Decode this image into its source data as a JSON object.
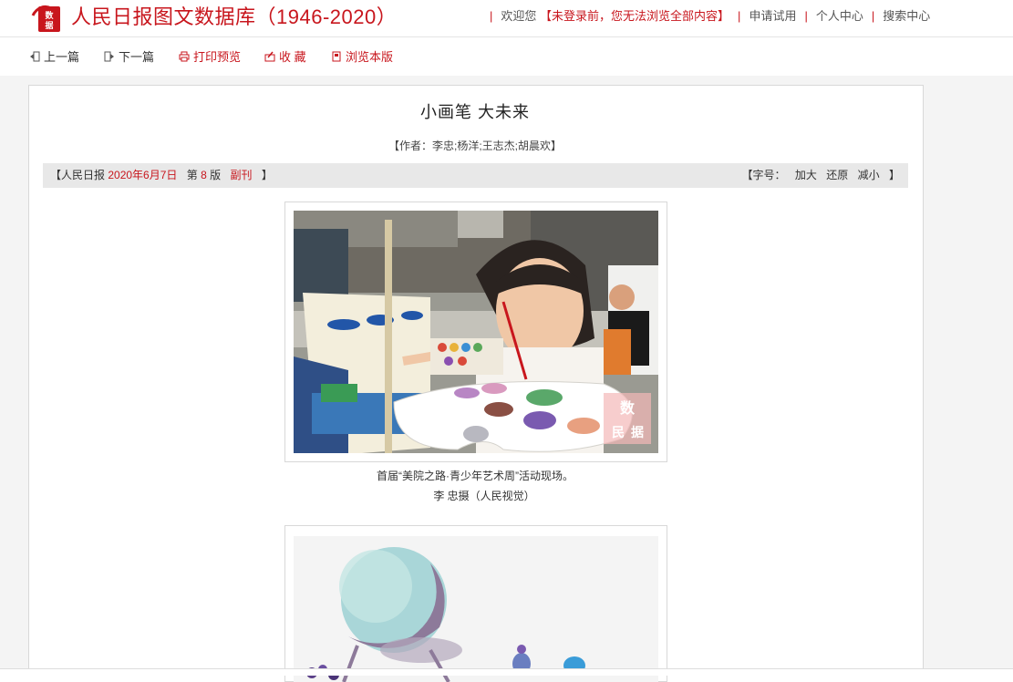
{
  "header": {
    "logo_text": "人民数据",
    "site_title": "人民日报图文数据库（1946-2020）",
    "welcome": "欢迎您",
    "login_warning": "【未登录前，您无法浏览全部内容】",
    "links": [
      "申请试用",
      "个人中心",
      "搜索中心"
    ]
  },
  "toolbar": {
    "prev": "上一篇",
    "next": "下一篇",
    "print": "打印预览",
    "favorite": "收 藏",
    "browse": "浏览本版"
  },
  "article": {
    "title": "小画笔  大未来",
    "author": "【作者：李忠;杨洋;王志杰;胡晨欢】"
  },
  "info": {
    "open": "【人民日报",
    "date": "2020年6月7日",
    "page_prefix": "第",
    "page_num": "8",
    "page_suffix": "版",
    "section": "副刊",
    "close": "】",
    "font_label": "【字号：",
    "enlarge": "加大",
    "restore": "还原",
    "shrink": "减小",
    "font_close": "】"
  },
  "photo1": {
    "caption": "首届“美院之路·青少年艺术周”活动现场。",
    "credit": "李 忠摄（人民视觉）",
    "watermark": "人民数据"
  },
  "colors": {
    "brand_red": "#c8161d",
    "gray_text": "#333333",
    "infobar_bg": "#e8e8e8"
  }
}
